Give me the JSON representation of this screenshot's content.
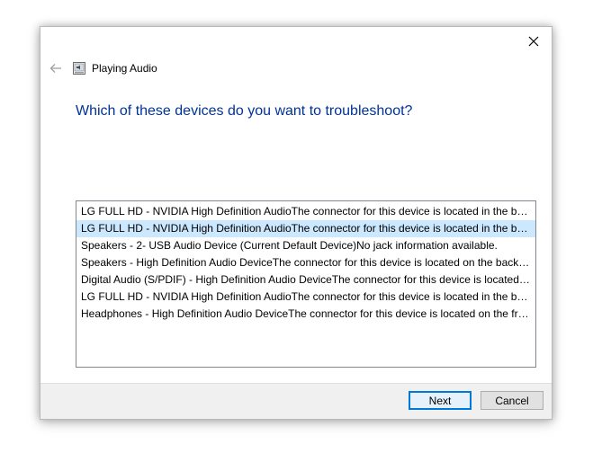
{
  "window": {
    "title": "Playing Audio",
    "close_icon": "close-icon",
    "back_icon": "back-arrow-icon",
    "app_icon": "troubleshooter-icon"
  },
  "main": {
    "instruction": "Which of these devices do you want to troubleshoot?",
    "devices": [
      {
        "label": "LG FULL HD - NVIDIA High Definition AudioThe connector for this device is located in the back panel."
      },
      {
        "label": "LG FULL HD - NVIDIA High Definition AudioThe connector for this device is located in the back panel.",
        "selected": true
      },
      {
        "label": "Speakers - 2- USB Audio Device (Current Default Device)No jack information available."
      },
      {
        "label": "Speakers - High Definition Audio DeviceThe connector for this device is located on the back panel."
      },
      {
        "label": "Digital Audio (S/PDIF) - High Definition Audio DeviceThe connector for this device is located on the back panel."
      },
      {
        "label": "LG FULL HD - NVIDIA High Definition AudioThe connector for this device is located in the back panel."
      },
      {
        "label": "Headphones - High Definition Audio DeviceThe connector for this device is located on the front panel."
      }
    ]
  },
  "footer": {
    "next_label": "Next",
    "cancel_label": "Cancel"
  },
  "colors": {
    "instruction_text": "#003399",
    "selection_bg": "#cce8ff",
    "footer_bg": "#f0f0f0",
    "default_button_border": "#0078d7"
  }
}
